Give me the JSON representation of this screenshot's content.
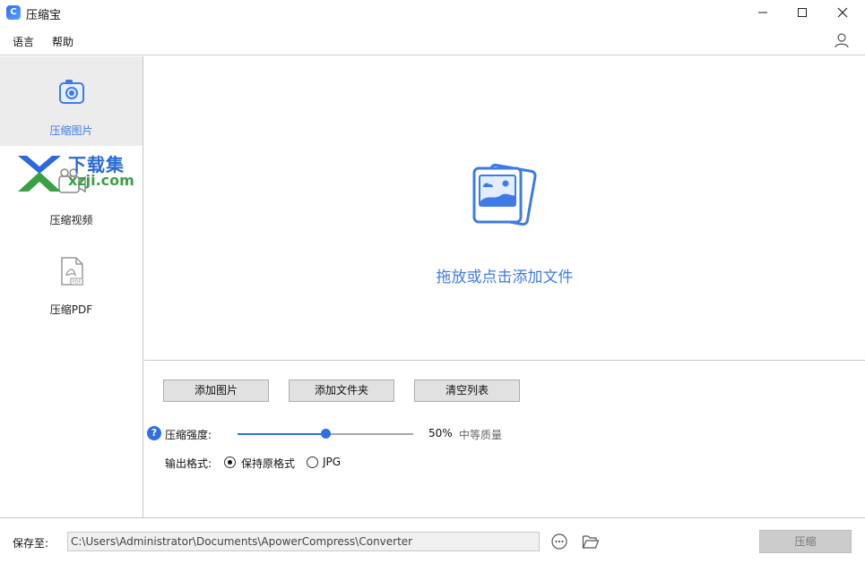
{
  "window": {
    "title": "压缩宝",
    "app_icon_glyph": "C"
  },
  "menu": {
    "language": "语言",
    "help": "帮助"
  },
  "sidebar": {
    "items": [
      {
        "label": "压缩图片",
        "icon": "image-compress-icon",
        "active": true
      },
      {
        "label": "压缩视频",
        "icon": "video-compress-icon",
        "active": false
      },
      {
        "label": "压缩PDF",
        "icon": "pdf-compress-icon",
        "active": false
      }
    ]
  },
  "watermark": {
    "top": "下载集",
    "bottom": "xzji.com"
  },
  "dropzone": {
    "text": "拖放或点击添加文件",
    "icon": "photo-stack-icon"
  },
  "controls": {
    "add_images": "添加图片",
    "add_folder": "添加文件夹",
    "clear_list": "清空列表",
    "help_glyph": "?",
    "strength_label": "压缩强度:",
    "strength_percent": "50%",
    "strength_value": 0.5,
    "quality_text": "中等质量",
    "format_label": "输出格式:",
    "format_keep": "保持原格式",
    "format_jpg": "JPG",
    "format_selected": "keep"
  },
  "bottom": {
    "save_label": "保存至:",
    "save_path": "C:\\Users\\Administrator\\Documents\\ApowerCompress\\Converter",
    "compress": "压缩"
  },
  "colors": {
    "accent": "#3f7be6",
    "sidebar_active": "#ececec",
    "button_bg": "#e1e1e1"
  }
}
